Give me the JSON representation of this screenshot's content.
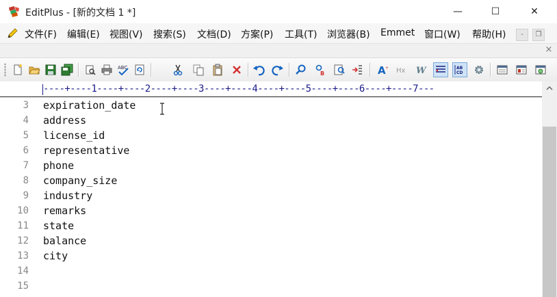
{
  "window": {
    "title": "EditPlus - [新的文档 1 *]",
    "controls": {
      "minimize": "—",
      "maximize": "☐",
      "close": "✕"
    }
  },
  "menu": {
    "items": [
      {
        "label": "文件(F)"
      },
      {
        "label": "编辑(E)"
      },
      {
        "label": "视图(V)"
      },
      {
        "label": "搜索(S)"
      },
      {
        "label": "文档(D)"
      },
      {
        "label": "方案(P)"
      },
      {
        "label": "工具(T)"
      },
      {
        "label": "浏览器(B)"
      },
      {
        "label": "Emmet"
      },
      {
        "label": "窗口(W)"
      },
      {
        "label": "帮助(H)"
      }
    ],
    "mdi_minimize": "-",
    "mdi_restore": "❐"
  },
  "document": {
    "close_glyph": "×"
  },
  "toolbar": {
    "buttons": [
      {
        "icon": "new-file-icon"
      },
      {
        "icon": "open-folder-icon"
      },
      {
        "icon": "save-icon"
      },
      {
        "icon": "save-all-icon"
      },
      {
        "icon": "print-preview-icon"
      },
      {
        "icon": "print-icon"
      },
      {
        "icon": "spellcheck-icon"
      },
      {
        "icon": "refresh-icon"
      },
      {
        "icon": "cut-icon"
      },
      {
        "icon": "copy-icon"
      },
      {
        "icon": "paste-icon"
      },
      {
        "icon": "delete-icon"
      },
      {
        "icon": "undo-icon"
      },
      {
        "icon": "redo-icon"
      },
      {
        "icon": "find-icon"
      },
      {
        "icon": "replace-icon"
      },
      {
        "icon": "find-in-files-icon"
      },
      {
        "icon": "goto-line-icon"
      },
      {
        "icon": "font-size-icon"
      },
      {
        "icon": "hex-icon"
      },
      {
        "icon": "word-wrap-icon"
      },
      {
        "icon": "line-numbers-icon"
      },
      {
        "icon": "ruler-icon"
      },
      {
        "icon": "settings-gear-icon"
      },
      {
        "icon": "directory-window-icon"
      },
      {
        "icon": "cliptext-window-icon"
      },
      {
        "icon": "browser-window-icon"
      }
    ],
    "labels": {
      "hex": "Hx",
      "word_wrap": "W",
      "font_size": "A"
    }
  },
  "ruler": {
    "text": "----+----1----+----2----+----3----+----4----+----5----+----6----+----7---"
  },
  "editor": {
    "lines": [
      {
        "num": "3",
        "text": "expiration_date"
      },
      {
        "num": "4",
        "text": "address"
      },
      {
        "num": "5",
        "text": "license_id"
      },
      {
        "num": "6",
        "text": "representative"
      },
      {
        "num": "7",
        "text": "phone"
      },
      {
        "num": "8",
        "text": "company_size"
      },
      {
        "num": "9",
        "text": "industry"
      },
      {
        "num": "10",
        "text": "remarks"
      },
      {
        "num": "11",
        "text": "state"
      },
      {
        "num": "12",
        "text": "balance"
      },
      {
        "num": "13",
        "text": "city"
      },
      {
        "num": "14",
        "text": ""
      },
      {
        "num": "15",
        "text": ""
      }
    ]
  },
  "colors": {
    "ruler_text": "#1a1a8a",
    "line_numbers": "#888888",
    "toolbar_active": "#cfe3f7"
  }
}
